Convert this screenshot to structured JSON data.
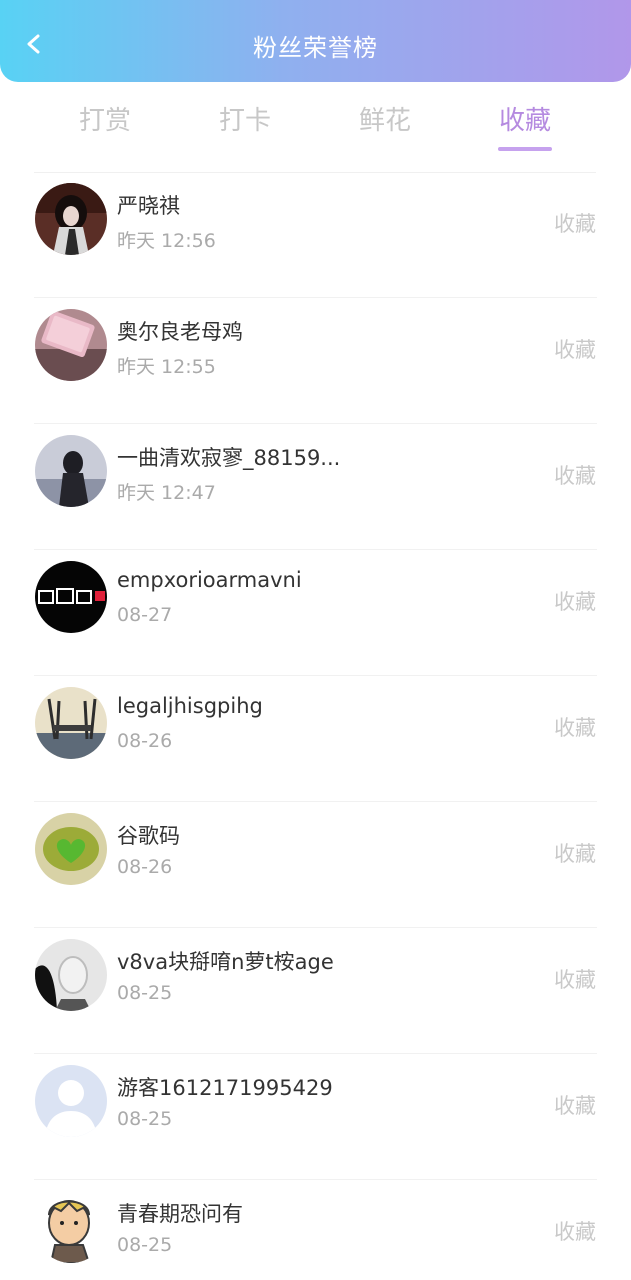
{
  "header": {
    "title": "粉丝荣誉榜",
    "back_icon": "chevron-left-icon",
    "gradient": [
      "#58d2f4",
      "#b197ea"
    ]
  },
  "tabs": [
    {
      "label": "打赏",
      "active": false
    },
    {
      "label": "打卡",
      "active": false
    },
    {
      "label": "鲜花",
      "active": false
    },
    {
      "label": "收藏",
      "active": true
    }
  ],
  "colors": {
    "accent": "#b58ae0",
    "tab_inactive": "#c7c7c7",
    "muted_text": "#aaaaaa"
  },
  "fans": [
    {
      "name": "严晓祺",
      "time": "昨天 12:56",
      "action": "收藏"
    },
    {
      "name": "奥尔良老母鸡",
      "time": "昨天 12:55",
      "action": "收藏"
    },
    {
      "name": "一曲清欢寂寥_88159...",
      "time": "昨天 12:47",
      "action": "收藏"
    },
    {
      "name": "empxorioarmavni",
      "time": "08-27",
      "action": "收藏"
    },
    {
      "name": "legaljhisgpihg",
      "time": "08-26",
      "action": "收藏"
    },
    {
      "name": "谷歌码",
      "time": "08-26",
      "action": "收藏"
    },
    {
      "name": "v8va块搿唷n萝t桉age",
      "time": "08-25",
      "action": "收藏"
    },
    {
      "name": "游客1612171995429",
      "time": "08-25",
      "action": "收藏"
    },
    {
      "name": "青春期恐问有",
      "time": "08-25",
      "action": "收藏"
    }
  ]
}
